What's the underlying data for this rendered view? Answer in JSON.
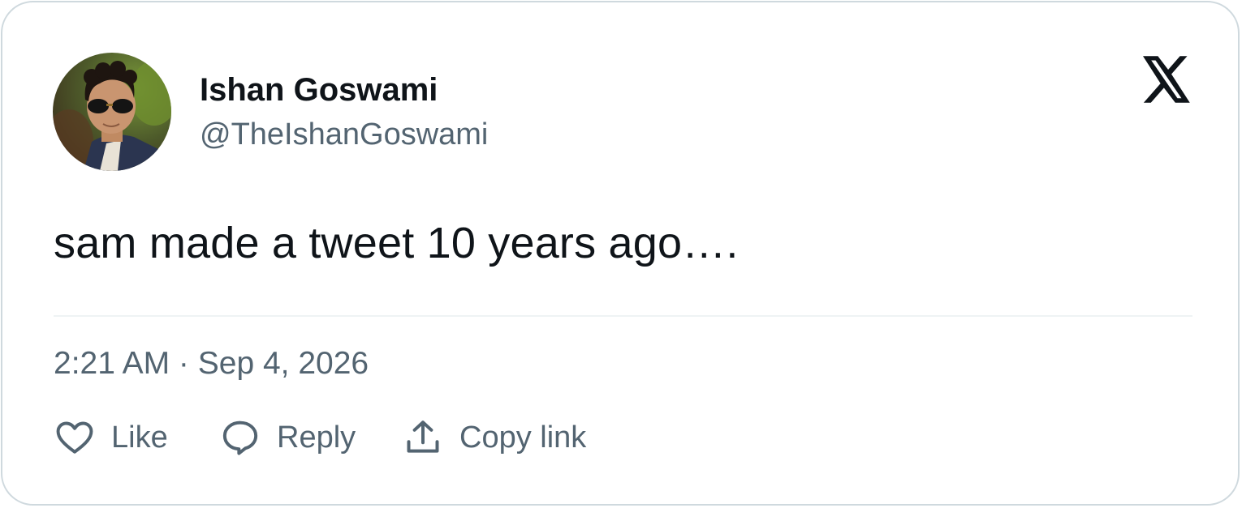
{
  "author": {
    "name": "Ishan Goswami",
    "handle": "@TheIshanGoswami"
  },
  "tweet": {
    "text": "sam made a tweet 10 years ago….",
    "timestamp": "2:21 AM · Sep 4, 2026"
  },
  "actions": [
    {
      "label": "Like",
      "icon": "heart-icon"
    },
    {
      "label": "Reply",
      "icon": "speech-bubble-icon"
    },
    {
      "label": "Copy link",
      "icon": "share-upload-icon"
    }
  ],
  "brand": {
    "icon": "x-logo-icon"
  },
  "colors": {
    "text_primary": "#0f1419",
    "text_secondary": "#536471",
    "border": "#cfd9de",
    "divider": "#eff3f4"
  }
}
